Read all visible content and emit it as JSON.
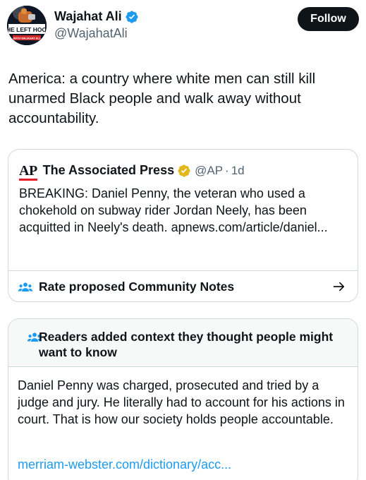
{
  "author": {
    "display_name": "Wajahat Ali",
    "handle": "@WajahatAli",
    "verified_icon": "verified-badge-blue",
    "avatar": {
      "brand_text": "THE LEFT HOOK",
      "sub_text": "WITH WAJAHAT ALI"
    }
  },
  "follow_label": "Follow",
  "tweet_text": "America: a country where white men can still kill unarmed Black people and walk away without accountability.",
  "quote": {
    "logo_text": "AP",
    "name": "The Associated Press",
    "badge_icon": "verified-badge-gold",
    "handle": "@AP",
    "separator": "·",
    "time": "1d",
    "text": "BREAKING: Daniel Penny, the veteran who used a chokehold on subway rider Jordan Neely, has been acquitted in Neely's death.  apnews.com/article/daniel..."
  },
  "rate_notes": {
    "label": "Rate proposed Community Notes",
    "icon": "people-icon",
    "arrow": "arrow-right-icon"
  },
  "community_note": {
    "title": "Readers added context they thought people might want to know",
    "body": "Daniel Penny was charged, prosecuted and tried by a judge and jury. He literally had to account for his actions in court. That is how our society holds people accountable.",
    "link": "merriam-webster.com/dictionary/acc..."
  },
  "colors": {
    "text": "#0f1419",
    "secondary": "#536471",
    "link": "#1d9bf0",
    "border": "#cfd9de",
    "verified_blue": "#1d9bf0",
    "verified_gold": "#e2b719",
    "ap_red": "#e31b23"
  }
}
